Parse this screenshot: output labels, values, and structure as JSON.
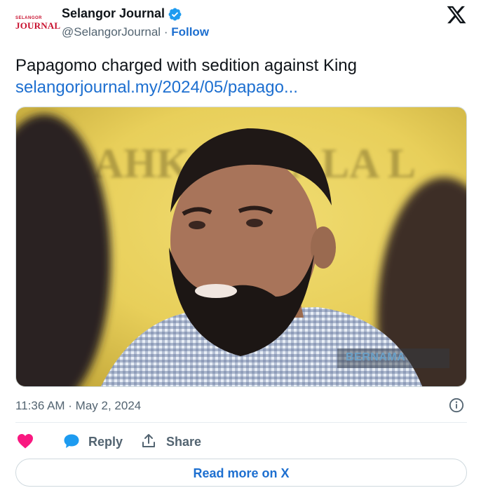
{
  "author": {
    "logo_small": "SELANGOR",
    "logo_big": "JOURNAL",
    "name": "Selangor Journal",
    "handle": "@SelangorJournal",
    "separator": "·",
    "follow_label": "Follow",
    "verified": true
  },
  "tweet": {
    "text": "Papagomo charged with sedition against King",
    "link": "selangorjournal.my/2024/05/papago..."
  },
  "image": {
    "watermark": "BERNAMA",
    "background_text": "AHKA  KUALA L"
  },
  "meta": {
    "timestamp": "11:36 AM · May 2, 2024"
  },
  "actions": {
    "reply_label": "Reply",
    "share_label": "Share",
    "read_more_label": "Read more on X"
  },
  "colors": {
    "link": "#1d6fd0",
    "heart": "#f91880",
    "verified": "#1d9bf0",
    "brand_red": "#c8102e"
  }
}
